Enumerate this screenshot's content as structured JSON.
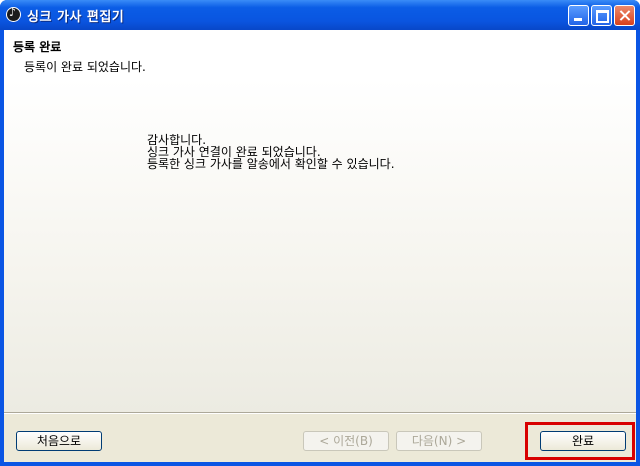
{
  "window": {
    "title": "싱크 가사 편집기"
  },
  "header": {
    "title": "등록 완료",
    "subtitle": "등록이 완료 되었습니다."
  },
  "content": {
    "lines": [
      "감사합니다.",
      "싱크 가사 연결이 완료 되었습니다.",
      "등록한 싱크 가사를 알송에서 확인할 수 있습니다."
    ]
  },
  "footer": {
    "first_label": "처음으로",
    "prev_label": "< 이전(B)",
    "next_label": "다음(N) >",
    "finish_label": "완료"
  },
  "colors": {
    "titlebar": "#0a55e4",
    "highlight": "#d80000",
    "face": "#ece9d8"
  },
  "icons": {
    "app": "music-note-icon",
    "minimize": "minimize-icon",
    "maximize": "maximize-icon",
    "close": "close-icon"
  }
}
